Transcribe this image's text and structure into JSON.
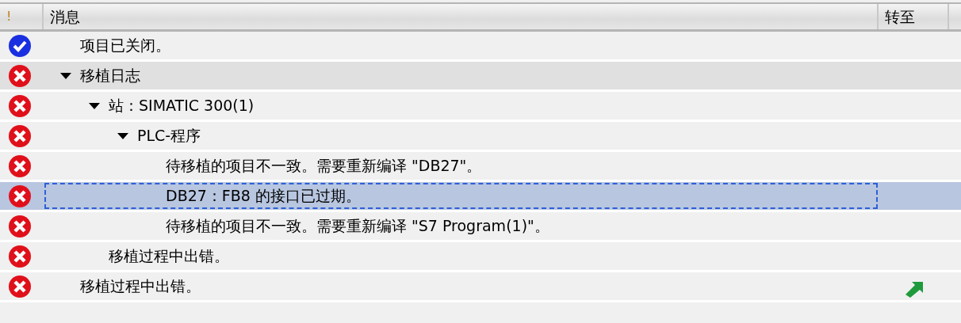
{
  "columns": {
    "status": "!",
    "message": "消息",
    "goto": "转至"
  },
  "rows": [
    {
      "kind": "success",
      "text": "项目已关闭。",
      "selected": false,
      "highlighted": false,
      "goto": false
    },
    {
      "kind": "error",
      "text": "移植日志",
      "expanded": true,
      "selected": false,
      "highlighted": true,
      "goto": false,
      "children": [
        {
          "kind": "error",
          "text": "站：SIMATIC 300(1)",
          "expanded": true,
          "selected": false,
          "highlighted": false,
          "goto": false,
          "children": [
            {
              "kind": "error",
              "text": "PLC-程序",
              "expanded": true,
              "selected": false,
              "highlighted": false,
              "goto": false,
              "children": [
                {
                  "kind": "error",
                  "text": "待移植的项目不一致。需要重新编译 \"DB27\"。",
                  "selected": false,
                  "highlighted": false,
                  "goto": false
                },
                {
                  "kind": "error",
                  "text": "DB27：FB8 的接口已过期。",
                  "selected": true,
                  "highlighted": false,
                  "goto": false
                },
                {
                  "kind": "error",
                  "text": "待移植的项目不一致。需要重新编译 \"S7 Program(1)\"。",
                  "selected": false,
                  "highlighted": false,
                  "goto": false
                }
              ]
            }
          ]
        },
        {
          "kind": "error",
          "text": "移植过程中出错。",
          "selected": false,
          "highlighted": false,
          "goto": false
        }
      ]
    },
    {
      "kind": "error",
      "text": "移植过程中出错。",
      "selected": false,
      "highlighted": false,
      "goto": true
    }
  ]
}
